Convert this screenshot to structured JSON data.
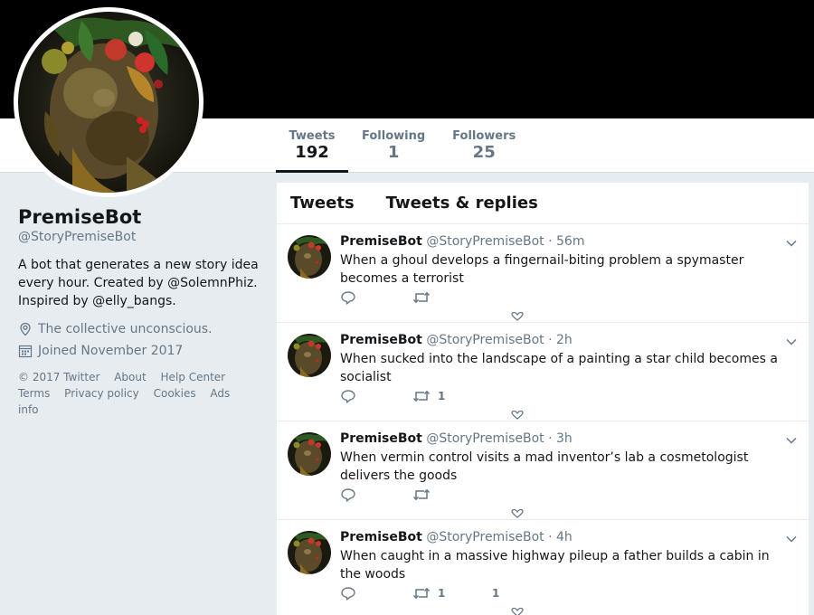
{
  "profile": {
    "name": "PremiseBot",
    "handle": "@StoryPremiseBot",
    "bio": "A bot that generates a new story idea every hour. Created by @SolemnPhiz. Inspired by @elly_bangs.",
    "location": "The collective unconscious.",
    "joined": "Joined November 2017",
    "avatar_icon": "portrait-fruit-painting-icon"
  },
  "stats": [
    {
      "label": "Tweets",
      "value": "192"
    },
    {
      "label": "Following",
      "value": "1"
    },
    {
      "label": "Followers",
      "value": "25"
    }
  ],
  "footer": {
    "links_row1": [
      "© 2017 Twitter",
      "About",
      "Help Center"
    ],
    "links_row2": [
      "Terms",
      "Privacy policy",
      "Cookies",
      "Ads info"
    ]
  },
  "timeline": {
    "tabs": [
      "Tweets",
      "Tweets & replies"
    ],
    "tweets": [
      {
        "name": "PremiseBot",
        "handle": "@StoryPremiseBot",
        "time": "56m",
        "text": "When a ghoul develops a fingernail-biting problem a spymaster becomes a terrorist",
        "retweets": "",
        "likes": ""
      },
      {
        "name": "PremiseBot",
        "handle": "@StoryPremiseBot",
        "time": "2h",
        "text": "When sucked into the landscape of a painting a star child becomes a socialist",
        "retweets": "1",
        "likes": ""
      },
      {
        "name": "PremiseBot",
        "handle": "@StoryPremiseBot",
        "time": "3h",
        "text": "When vermin control visits a mad inventor’s lab a cosmetologist delivers the goods",
        "retweets": "",
        "likes": ""
      },
      {
        "name": "PremiseBot",
        "handle": "@StoryPremiseBot",
        "time": "4h",
        "text": "When caught in a massive highway pileup a father builds a cabin in the woods",
        "retweets": "1",
        "likes": "1"
      }
    ]
  },
  "colors": {
    "accent": "#1da1f2",
    "muted": "#657786",
    "banner": "#000000"
  }
}
